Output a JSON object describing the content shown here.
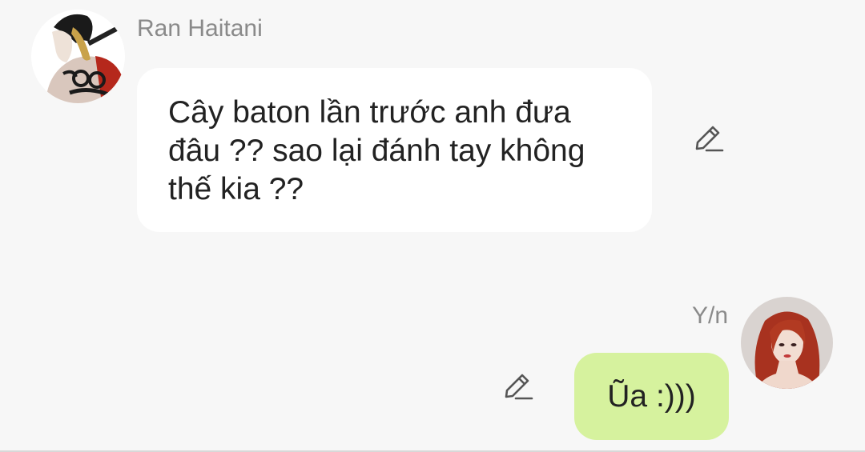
{
  "messages": [
    {
      "sender": "Ran Haitani",
      "side": "left",
      "text_lines": [
        "Cây baton lần trước anh đưa",
        "đâu ?? sao lại đánh tay không",
        "thế kia ??"
      ],
      "bubble_color": "#ffffff",
      "avatar_icon": "character-avatar-tattooed-man",
      "edit_icon": "pencil-edit-icon"
    },
    {
      "sender": "Y/n",
      "side": "right",
      "text_lines": [
        "Ũa :)))"
      ],
      "bubble_color": "#d6f29e",
      "avatar_icon": "character-avatar-red-haired-woman",
      "edit_icon": "pencil-edit-icon"
    }
  ],
  "colors": {
    "background": "#f7f7f7",
    "name_text": "#8a8a8a",
    "message_text": "#222222"
  }
}
